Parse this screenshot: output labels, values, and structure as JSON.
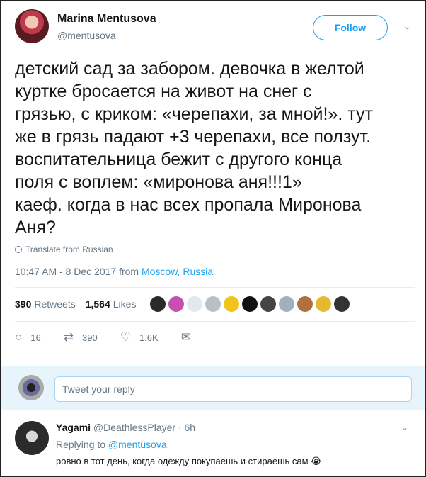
{
  "tweet": {
    "author_name": "Marina Mentusova",
    "author_handle": "@mentusova",
    "follow_label": "Follow",
    "text": "детский сад за забором. девочка в желтой\nкуртке бросается на живот на снег с\nгрязью, с криком: «черепахи, за мной!». тут\nже в грязь падают +3 черепахи, все ползут.\nвоспитательница бежит с другого конца\nполя с воплем: «миронова аня!!!1»\nкаеф. когда в нас всех пропала Миронова\nАня?",
    "translate_label": "Translate from Russian",
    "timestamp": "10:47 AM - 8 Dec 2017",
    "from_label": "from",
    "location": "Moscow, Russia",
    "retweets_count": "390",
    "retweets_label": "Retweets",
    "likes_count": "1,564",
    "likes_label": "Likes",
    "liker_colors": [
      "#2a2a2a",
      "#c84fb0",
      "#e3e8ec",
      "#b8c0c8",
      "#f2c31a",
      "#111111",
      "#444444",
      "#9fb0c0",
      "#b07040",
      "#e5b830",
      "#333333"
    ],
    "actions": {
      "reply_count": "16",
      "retweet_count": "390",
      "like_count": "1.6K"
    }
  },
  "reply_box": {
    "placeholder": "Tweet your reply"
  },
  "reply": {
    "name": "Yagami",
    "handle": "@DeathlessPlayer",
    "time": "· 6h",
    "replying_label": "Replying to",
    "replying_to": "@mentusova",
    "text": "ровно в тот день, когда одежду покупаешь и стираешь сам 😭"
  },
  "icons": {
    "caret": "chevron-down-icon",
    "globe": "globe-icon",
    "reply": "reply-icon",
    "retweet": "retweet-icon",
    "like": "heart-icon",
    "dm": "envelope-icon"
  }
}
